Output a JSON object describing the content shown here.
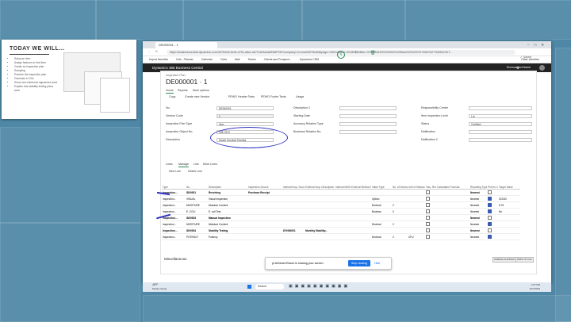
{
  "slide": {
    "title": "TODAY WE WILL…",
    "items": [
      "Setup an item",
      "Assign features to that item",
      "Create an inspection plan",
      "Sampling",
      "Execute the inspection plan",
      "Generate a COA",
      "Show new electronic signatures work",
      "Explain how stability testing plans work"
    ]
  },
  "browser": {
    "tab_title": "DE000001 - 1",
    "url": "https://businesscentral.dynamics.com/4b7fe0e0-5c0e-470c-a8ce-ab7111b5a4a8/NWPON?company=CronusSATStufAt&page=%20rollasoe=2018070&filter=%27PB3430%202002%20Maz%20%20%27ANG%27%20No%27...",
    "bookmarks": [
      "Import favorites",
      "Hub - Planner",
      "Calendar",
      "Tools",
      "Mail",
      "Teams",
      "Clients and Prospect...",
      "Dynamics CRM"
    ],
    "other_favorites": "Other favorites"
  },
  "bc": {
    "app_title": "Dynamics 365 Business Central",
    "user": "Environment Name"
  },
  "page": {
    "caption": "Inspection Plan",
    "title": "DE000001 · 1",
    "saved": "✓ Saved",
    "tabs": [
      "Home",
      "Reports",
      "More options"
    ],
    "actions": [
      "Copy",
      "Create new Version",
      "PEWO Header Tests",
      "PEWO Footer Tests",
      "Usage"
    ],
    "fields_left": [
      {
        "label": "No.",
        "value": "DE000001",
        "gray": false
      },
      {
        "label": "Version Code",
        "value": "1",
        "gray": true
      },
      {
        "label": "Inspection Plan Type",
        "value": "Item",
        "gray": false
      },
      {
        "label": "Inspection Object No.",
        "value": "158-7512",
        "gray": false
      },
      {
        "label": "Description",
        "value": "Sweet Smoked Paprika",
        "gray": false
      }
    ],
    "fields_mid": [
      {
        "label": "Description 2",
        "value": ""
      },
      {
        "label": "Starting Date",
        "value": ""
      },
      {
        "label": "Accuracy Relation Type",
        "value": ""
      },
      {
        "label": "Business Relation No.",
        "value": ""
      }
    ],
    "fields_right": [
      {
        "label": "Responsibility Center",
        "value": ""
      },
      {
        "label": "Item Inspection Level",
        "value": "Lot"
      },
      {
        "label": "Status",
        "value": "Certified"
      },
      {
        "label": "Notification",
        "value": ""
      },
      {
        "label": "Notification 2",
        "value": ""
      }
    ]
  },
  "lines": {
    "tabs": [
      "Lines",
      "Manage",
      "Line",
      "More Lines"
    ],
    "actions": [
      "New Line",
      "Delete Line"
    ],
    "headers": [
      "Type",
      "No.",
      "Description",
      "Inspection Source",
      "Internal Insp. Source",
      "External Insp. Description",
      "Internal Method No.",
      "External Method No.",
      "Value Type",
      "No. of Decimals",
      "Unit of Measure Code",
      "Visu. Req.",
      "Calculation Formula",
      "Reporting Type",
      "Print in CoA",
      "Target Value"
    ],
    "rows": [
      {
        "bold": true,
        "cells": [
          "Inspection...",
          "ID00001",
          "Receiving",
          "Purchase Receipt",
          "",
          "",
          "",
          "",
          "",
          "",
          "",
          "",
          "",
          "Nearest",
          "",
          ""
        ],
        "check": false
      },
      {
        "bold": false,
        "cells": [
          "Inspection...",
          "VISUAL",
          "Visual Inspection",
          "",
          "",
          "",
          "",
          "",
          "Option",
          "",
          "",
          "",
          "",
          "Nearest",
          "",
          "GOOD"
        ],
        "check": true
      },
      {
        "bold": false,
        "cells": [
          "Inspection...",
          "MOISTURE",
          "Moisture Content",
          "",
          "",
          "",
          "",
          "",
          "Decimal",
          "2",
          "",
          "",
          "",
          "Nearest",
          "",
          "6.75"
        ],
        "check": true
      },
      {
        "bold": false,
        "cells": [
          "Inspection...",
          "E. COLI",
          "E. coli Test",
          "",
          "",
          "",
          "",
          "",
          "Boolean",
          "0",
          "",
          "",
          "",
          "Nearest",
          "",
          "No"
        ],
        "check": true
      },
      {
        "bold": true,
        "cells": [
          "Inspection...",
          "ID00003",
          "Manual Inspection",
          "",
          "",
          "",
          "",
          "",
          "",
          "",
          "",
          "",
          "",
          "Nearest",
          "",
          ""
        ],
        "check": false
      },
      {
        "bold": false,
        "cells": [
          "Inspection...",
          "MOISTURE",
          "Moisture Content",
          "",
          "",
          "",
          "",
          "",
          "Decimal",
          "2",
          "",
          "",
          "",
          "Nearest",
          "",
          ""
        ],
        "check": true
      },
      {
        "bold": true,
        "cells": [
          "Inspection...",
          "ID00004",
          "Stability Testing",
          "",
          "DYN00001",
          "Monthly Stability...",
          "",
          "",
          "",
          "",
          "",
          "",
          "",
          "Nearest",
          "",
          ""
        ],
        "check": false
      },
      {
        "bold": false,
        "cells": [
          "Inspection...",
          "POTENCY",
          "Potency",
          "",
          "",
          "",
          "",
          "",
          "Decimal",
          "2",
          "CFU",
          "",
          "",
          "Nearest",
          "",
          ""
        ],
        "check": true
      }
    ]
  },
  "misc": {
    "label": "Miscellaneous",
    "btn1": "SAMPLE PLANNING",
    "btn2": "PRINT IN COA"
  },
  "share": {
    "text": "pr.teDecer2/hcum is sharing your screen.",
    "stop": "Stop sharing",
    "hide": "Hide"
  },
  "taskbar": {
    "weather": "48°F",
    "weather2": "Mostly cloudy",
    "search": "Search",
    "time": "2:27 PM",
    "date": "2/27/2023"
  }
}
